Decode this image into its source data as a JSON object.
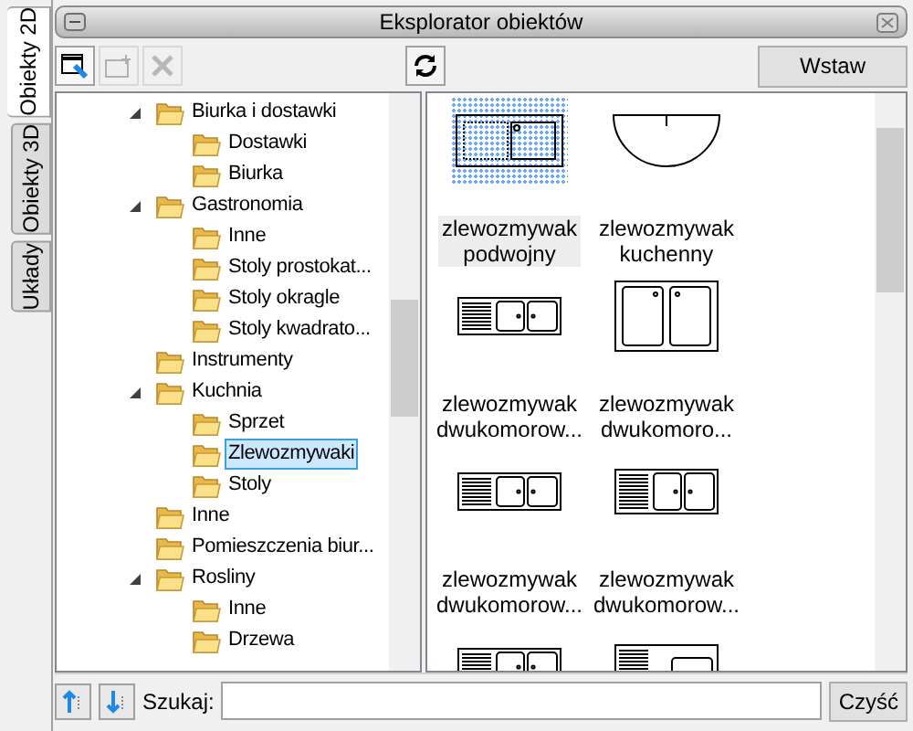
{
  "side_tabs": [
    {
      "label": "Obiekty 2D",
      "selected": true
    },
    {
      "label": "Obiekty 3D",
      "selected": false
    },
    {
      "label": "Układy",
      "selected": false
    }
  ],
  "window": {
    "title": "Eksplorator obiektów"
  },
  "toolbar": {
    "insert_button": "Wstaw"
  },
  "tree": [
    {
      "label": "Biurka i dostawki",
      "selected": false,
      "expanded": true,
      "children": [
        {
          "label": "Dostawki",
          "selected": false
        },
        {
          "label": "Biurka",
          "selected": false
        }
      ]
    },
    {
      "label": "Gastronomia",
      "selected": false,
      "expanded": true,
      "children": [
        {
          "label": "Inne",
          "selected": false
        },
        {
          "label": "Stoly prostokat...",
          "selected": false
        },
        {
          "label": "Stoly okragle",
          "selected": false
        },
        {
          "label": "Stoly kwadrato...",
          "selected": false
        }
      ]
    },
    {
      "label": "Instrumenty",
      "selected": false
    },
    {
      "label": "Kuchnia",
      "selected": false,
      "expanded": true,
      "children": [
        {
          "label": "Sprzet",
          "selected": false
        },
        {
          "label": "Zlewozmywaki",
          "selected": true
        },
        {
          "label": "Stoly",
          "selected": false
        }
      ]
    },
    {
      "label": "Inne",
      "selected": false
    },
    {
      "label": "Pomieszczenia biur...",
      "selected": false
    },
    {
      "label": "Rosliny",
      "selected": false,
      "expanded": true,
      "children": [
        {
          "label": "Inne",
          "selected": false
        },
        {
          "label": "Drzewa",
          "selected": false
        }
      ]
    }
  ],
  "items": [
    {
      "kind": "double-bowl",
      "label": "zlewozmywak",
      "label_2": "podwojny",
      "selected": true
    },
    {
      "kind": "half-round",
      "label": "zlewozmywak",
      "label_2": "kuchenny",
      "selected": false
    },
    {
      "kind": "drainer-two-bowls",
      "label": "zlewozmywak",
      "label_2": "dwukomorow...",
      "selected": false
    },
    {
      "kind": "two-tall-bowls",
      "label": "zlewozmywak",
      "label_2": "dwukomoro...",
      "selected": false
    },
    {
      "kind": "drainer-two-bowls",
      "label": "zlewozmywak",
      "label_2": "dwukomorow...",
      "selected": false
    },
    {
      "kind": "drainer-two-bowls-tall",
      "label": "zlewozmywak",
      "label_2": "dwukomorow...",
      "selected": false
    },
    {
      "kind": "drainer-two-bowls",
      "selected": false
    },
    {
      "kind": "drainer-one-bowl",
      "selected": false
    }
  ],
  "search": {
    "label": "Szukaj:",
    "clear_button": "Czyść"
  }
}
